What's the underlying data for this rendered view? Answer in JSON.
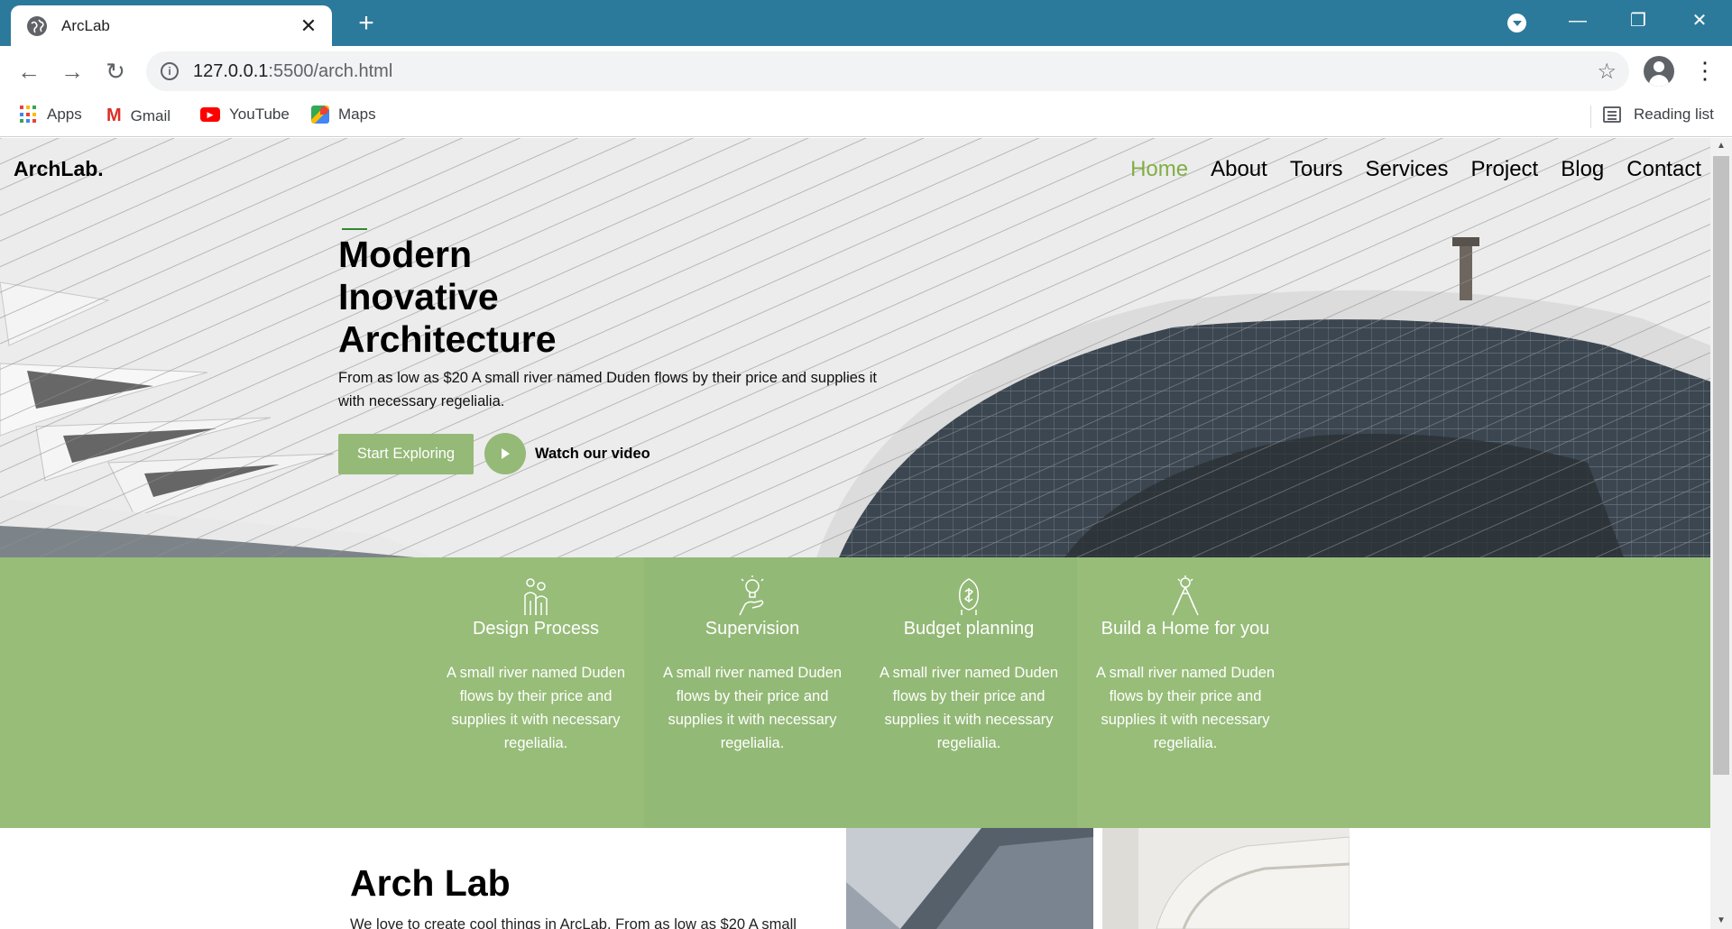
{
  "browser": {
    "tab_title": "ArcLab",
    "url_host": "127.0.0.1",
    "url_path": ":5500/arch.html",
    "bookmarks": [
      "Apps",
      "Gmail",
      "YouTube",
      "Maps"
    ],
    "reading_list": "Reading list"
  },
  "site": {
    "brand": "ArchLab.",
    "nav": [
      "Home",
      "About",
      "Tours",
      "Services",
      "Project",
      "Blog",
      "Contact"
    ],
    "active_nav": "Home",
    "accent_color": "#82ae46",
    "green_band_color": "#97bd79"
  },
  "hero": {
    "title": "Modern Inovative Architecture",
    "subtitle": "From as low as $20 A small river named Duden flows by their price and supplies it with necessary regelialia.",
    "cta_label": "Start Exploring",
    "video_label": "Watch our video"
  },
  "features": [
    {
      "title": "Design Process",
      "icon": "people-icon",
      "desc": "A small river named Duden flows by their price and supplies it with necessary regelialia."
    },
    {
      "title": "Supervision",
      "icon": "lightbulb-hand-icon",
      "desc": "A small river named Duden flows by their price and supplies it with necessary regelialia."
    },
    {
      "title": "Budget planning",
      "icon": "money-hand-icon",
      "desc": "A small river named Duden flows by their price and supplies it with necessary regelialia."
    },
    {
      "title": "Build a Home for you",
      "icon": "builder-icon",
      "desc": "A small river named Duden flows by their price and supplies it with necessary regelialia."
    }
  ],
  "about": {
    "title": "Arch Lab",
    "text": "We love to create cool things in ArcLab. From as low as $20 A small"
  }
}
